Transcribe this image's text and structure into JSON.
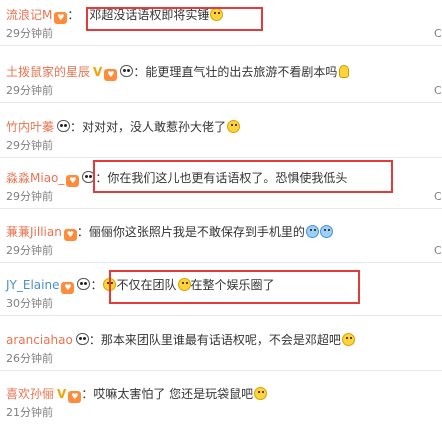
{
  "comments": [
    {
      "user": "流浪记M",
      "text": "邓超没话语权即将实锤",
      "time": "29分钟前",
      "side": "C"
    },
    {
      "user": "土拨鼠家的星辰",
      "text": "能更理直气壮的出去旅游不看剧本吗",
      "time": "29分钟前",
      "side": "C"
    },
    {
      "user": "竹内叶蓁",
      "text": "对对对，没人敢惹孙大佬了",
      "time": "29分钟前",
      "side": ""
    },
    {
      "user": "淼淼Miao_",
      "text": "你在我们这儿也更有话语权了。恐惧使我低头",
      "time": "29分钟前",
      "side": "C"
    },
    {
      "user": "蒹蒹Jillian",
      "text": "俪俪你这张照片我是不敢保存到手机里的",
      "time": "29分钟前",
      "side": "C"
    },
    {
      "user": "JY_Elaine",
      "text_a": "不仅在团队",
      "text_b": "在整个娱乐圈了",
      "time": "30分钟前",
      "side": ""
    },
    {
      "user": "aranciahao",
      "text": "那本来团队里谁最有话语权呢，不会是邓超吧",
      "time": "26分钟前",
      "side": ""
    },
    {
      "user": "喜欢孙俪",
      "text": "哎嘛太害怕了 您还是玩袋鼠吧",
      "time": "21分钟前",
      "side": ""
    }
  ]
}
